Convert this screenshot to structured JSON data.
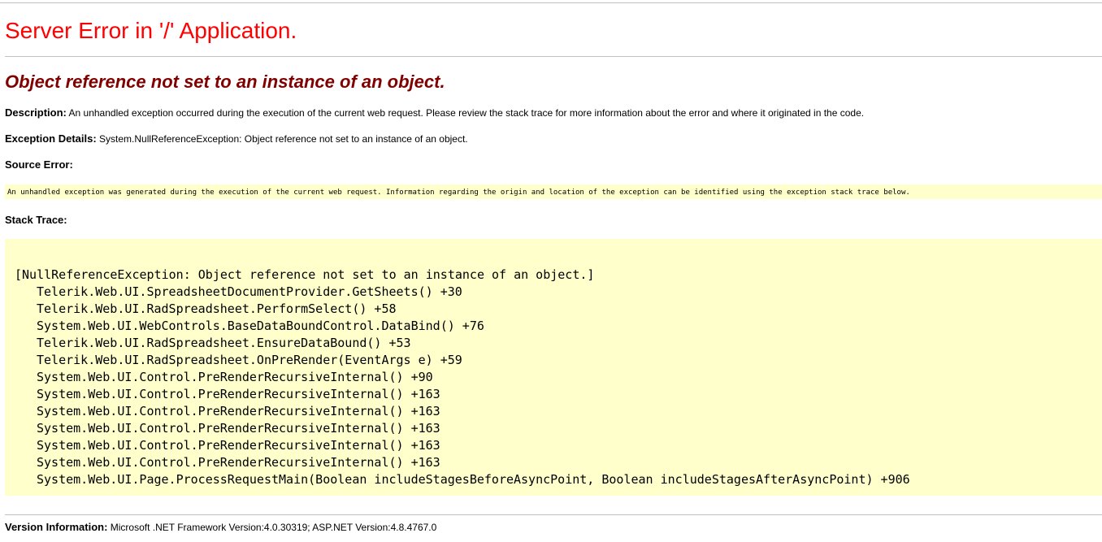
{
  "title": "Server Error in '/' Application.",
  "error_message": "Object reference not set to an instance of an object.",
  "description": {
    "label": "Description:",
    "text": "An unhandled exception occurred during the execution of the current web request. Please review the stack trace for more information about the error and where it originated in the code."
  },
  "exception_details": {
    "label": "Exception Details:",
    "text": "System.NullReferenceException: Object reference not set to an instance of an object."
  },
  "source_error": {
    "label": "Source Error:",
    "text": "An unhandled exception was generated during the execution of the current web request. Information regarding the origin and location of the exception can be identified using the exception stack trace below."
  },
  "stack_trace": {
    "label": "Stack Trace:",
    "exception": "[NullReferenceException: Object reference not set to an instance of an object.]",
    "frames": [
      "Telerik.Web.UI.SpreadsheetDocumentProvider.GetSheets() +30",
      "Telerik.Web.UI.RadSpreadsheet.PerformSelect() +58",
      "System.Web.UI.WebControls.BaseDataBoundControl.DataBind() +76",
      "Telerik.Web.UI.RadSpreadsheet.EnsureDataBound() +53",
      "Telerik.Web.UI.RadSpreadsheet.OnPreRender(EventArgs e) +59",
      "System.Web.UI.Control.PreRenderRecursiveInternal() +90",
      "System.Web.UI.Control.PreRenderRecursiveInternal() +163",
      "System.Web.UI.Control.PreRenderRecursiveInternal() +163",
      "System.Web.UI.Control.PreRenderRecursiveInternal() +163",
      "System.Web.UI.Control.PreRenderRecursiveInternal() +163",
      "System.Web.UI.Control.PreRenderRecursiveInternal() +163",
      "System.Web.UI.Page.ProcessRequestMain(Boolean includeStagesBeforeAsyncPoint, Boolean includeStagesAfterAsyncPoint) +906"
    ]
  },
  "version_info": {
    "label": "Version Information:",
    "text": "Microsoft .NET Framework Version:4.0.30319; ASP.NET Version:4.8.4767.0"
  },
  "colors": {
    "title": "#ff0000",
    "error_message": "#800000",
    "code_background": "#ffffcc",
    "rule": "#c0c0c0"
  }
}
